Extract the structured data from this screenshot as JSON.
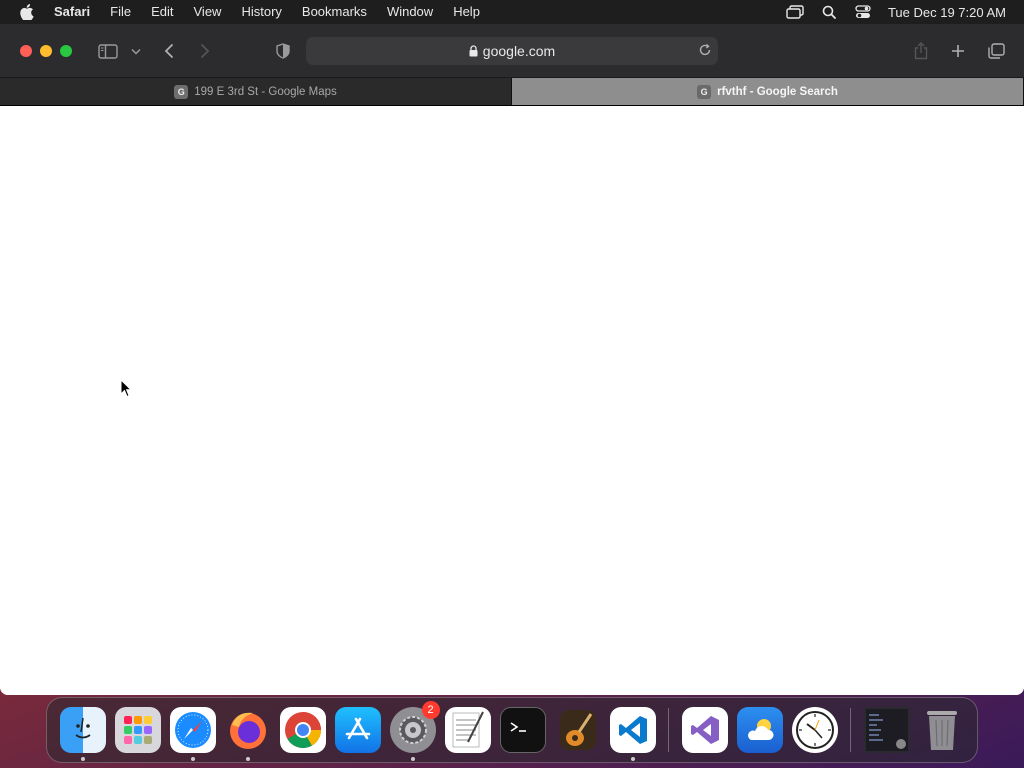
{
  "menubar": {
    "app_name": "Safari",
    "items": [
      "File",
      "Edit",
      "View",
      "History",
      "Bookmarks",
      "Window",
      "Help"
    ],
    "clock": "Tue Dec 19  7:20 AM"
  },
  "toolbar": {
    "url": "google.com"
  },
  "tabs": [
    {
      "title": "199 E 3rd St - Google Maps",
      "favicon": "G",
      "active": false
    },
    {
      "title": "rfvthf - Google Search",
      "favicon": "G",
      "active": true
    }
  ],
  "dock": {
    "settings_badge": "2",
    "apps": [
      "finder",
      "launchpad",
      "safari",
      "firefox",
      "chrome",
      "app-store",
      "system-preferences",
      "textedit",
      "terminal",
      "garageband",
      "vscode",
      "visual-studio",
      "weather",
      "clock",
      "screenshot-thumb",
      "trash"
    ]
  },
  "colors": {
    "close": "#ff5f57",
    "minimize": "#febc2e",
    "maximize": "#28c840",
    "toolbar_bg": "#2c2c2e"
  }
}
